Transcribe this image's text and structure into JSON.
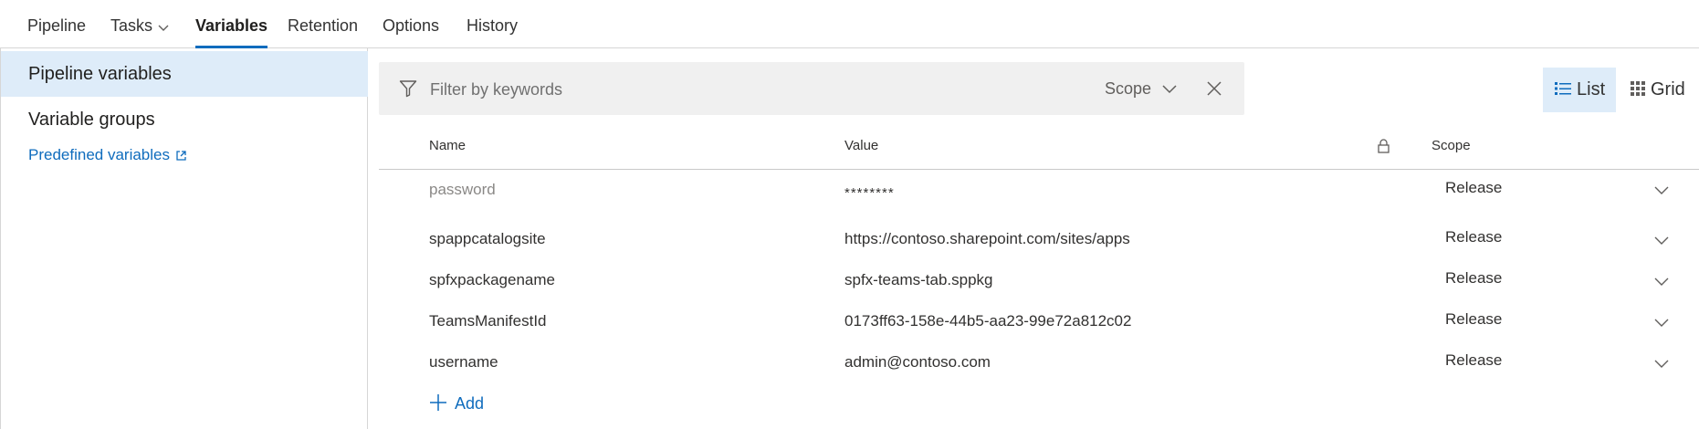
{
  "tabs": [
    {
      "label": "Pipeline"
    },
    {
      "label": "Tasks"
    },
    {
      "label": "Variables"
    },
    {
      "label": "Retention"
    },
    {
      "label": "Options"
    },
    {
      "label": "History"
    }
  ],
  "sidebar": {
    "items": [
      {
        "label": "Pipeline variables"
      },
      {
        "label": "Variable groups"
      }
    ],
    "link_label": "Predefined variables"
  },
  "filter": {
    "placeholder": "Filter by keywords",
    "scope_label": "Scope"
  },
  "view_toggle": {
    "list_label": "List",
    "grid_label": "Grid"
  },
  "table": {
    "headers": {
      "name": "Name",
      "value": "Value",
      "scope": "Scope"
    },
    "rows": [
      {
        "name": "password",
        "value": "********",
        "scope": "Release"
      },
      {
        "name": "spappcatalogsite",
        "value": "https://contoso.sharepoint.com/sites/apps",
        "scope": "Release"
      },
      {
        "name": "spfxpackagename",
        "value": "spfx-teams-tab.sppkg",
        "scope": "Release"
      },
      {
        "name": "TeamsManifestId",
        "value": "0173ff63-158e-44b5-aa23-99e72a812c02",
        "scope": "Release"
      },
      {
        "name": "username",
        "value": "admin@contoso.com",
        "scope": "Release"
      }
    ],
    "add_label": "Add"
  },
  "colors": {
    "accent": "#0f6cbd",
    "selected_bg": "#deecf9",
    "filter_bg": "#f0f0f0"
  },
  "icons": [
    "chevron-down-icon",
    "external-link-icon",
    "filter-icon",
    "close-icon",
    "list-icon",
    "grid-icon",
    "lock-icon",
    "plus-icon"
  ]
}
